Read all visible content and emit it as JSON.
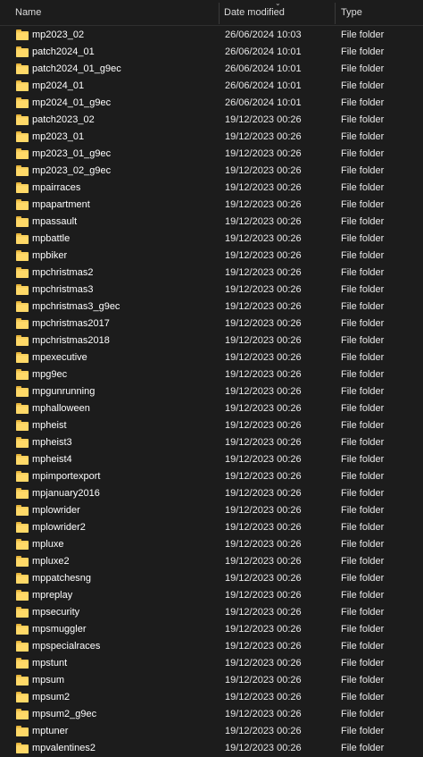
{
  "columns": {
    "name": "Name",
    "date_modified": "Date modified",
    "type": "Type"
  },
  "sort": {
    "column": "date_modified",
    "indicator_icon": "chevron-down-icon"
  },
  "rows": [
    {
      "name": "mp2023_02",
      "date": "26/06/2024 10:03",
      "type": "File folder"
    },
    {
      "name": "patch2024_01",
      "date": "26/06/2024 10:01",
      "type": "File folder"
    },
    {
      "name": "patch2024_01_g9ec",
      "date": "26/06/2024 10:01",
      "type": "File folder"
    },
    {
      "name": "mp2024_01",
      "date": "26/06/2024 10:01",
      "type": "File folder"
    },
    {
      "name": "mp2024_01_g9ec",
      "date": "26/06/2024 10:01",
      "type": "File folder"
    },
    {
      "name": "patch2023_02",
      "date": "19/12/2023 00:26",
      "type": "File folder"
    },
    {
      "name": "mp2023_01",
      "date": "19/12/2023 00:26",
      "type": "File folder"
    },
    {
      "name": "mp2023_01_g9ec",
      "date": "19/12/2023 00:26",
      "type": "File folder"
    },
    {
      "name": "mp2023_02_g9ec",
      "date": "19/12/2023 00:26",
      "type": "File folder"
    },
    {
      "name": "mpairraces",
      "date": "19/12/2023 00:26",
      "type": "File folder"
    },
    {
      "name": "mpapartment",
      "date": "19/12/2023 00:26",
      "type": "File folder"
    },
    {
      "name": "mpassault",
      "date": "19/12/2023 00:26",
      "type": "File folder"
    },
    {
      "name": "mpbattle",
      "date": "19/12/2023 00:26",
      "type": "File folder"
    },
    {
      "name": "mpbiker",
      "date": "19/12/2023 00:26",
      "type": "File folder"
    },
    {
      "name": "mpchristmas2",
      "date": "19/12/2023 00:26",
      "type": "File folder"
    },
    {
      "name": "mpchristmas3",
      "date": "19/12/2023 00:26",
      "type": "File folder"
    },
    {
      "name": "mpchristmas3_g9ec",
      "date": "19/12/2023 00:26",
      "type": "File folder"
    },
    {
      "name": "mpchristmas2017",
      "date": "19/12/2023 00:26",
      "type": "File folder"
    },
    {
      "name": "mpchristmas2018",
      "date": "19/12/2023 00:26",
      "type": "File folder"
    },
    {
      "name": "mpexecutive",
      "date": "19/12/2023 00:26",
      "type": "File folder"
    },
    {
      "name": "mpg9ec",
      "date": "19/12/2023 00:26",
      "type": "File folder"
    },
    {
      "name": "mpgunrunning",
      "date": "19/12/2023 00:26",
      "type": "File folder"
    },
    {
      "name": "mphalloween",
      "date": "19/12/2023 00:26",
      "type": "File folder"
    },
    {
      "name": "mpheist",
      "date": "19/12/2023 00:26",
      "type": "File folder"
    },
    {
      "name": "mpheist3",
      "date": "19/12/2023 00:26",
      "type": "File folder"
    },
    {
      "name": "mpheist4",
      "date": "19/12/2023 00:26",
      "type": "File folder"
    },
    {
      "name": "mpimportexport",
      "date": "19/12/2023 00:26",
      "type": "File folder"
    },
    {
      "name": "mpjanuary2016",
      "date": "19/12/2023 00:26",
      "type": "File folder"
    },
    {
      "name": "mplowrider",
      "date": "19/12/2023 00:26",
      "type": "File folder"
    },
    {
      "name": "mplowrider2",
      "date": "19/12/2023 00:26",
      "type": "File folder"
    },
    {
      "name": "mpluxe",
      "date": "19/12/2023 00:26",
      "type": "File folder"
    },
    {
      "name": "mpluxe2",
      "date": "19/12/2023 00:26",
      "type": "File folder"
    },
    {
      "name": "mppatchesng",
      "date": "19/12/2023 00:26",
      "type": "File folder"
    },
    {
      "name": "mpreplay",
      "date": "19/12/2023 00:26",
      "type": "File folder"
    },
    {
      "name": "mpsecurity",
      "date": "19/12/2023 00:26",
      "type": "File folder"
    },
    {
      "name": "mpsmuggler",
      "date": "19/12/2023 00:26",
      "type": "File folder"
    },
    {
      "name": "mpspecialraces",
      "date": "19/12/2023 00:26",
      "type": "File folder"
    },
    {
      "name": "mpstunt",
      "date": "19/12/2023 00:26",
      "type": "File folder"
    },
    {
      "name": "mpsum",
      "date": "19/12/2023 00:26",
      "type": "File folder"
    },
    {
      "name": "mpsum2",
      "date": "19/12/2023 00:26",
      "type": "File folder"
    },
    {
      "name": "mpsum2_g9ec",
      "date": "19/12/2023 00:26",
      "type": "File folder"
    },
    {
      "name": "mptuner",
      "date": "19/12/2023 00:26",
      "type": "File folder"
    },
    {
      "name": "mpvalentines2",
      "date": "19/12/2023 00:26",
      "type": "File folder"
    }
  ]
}
